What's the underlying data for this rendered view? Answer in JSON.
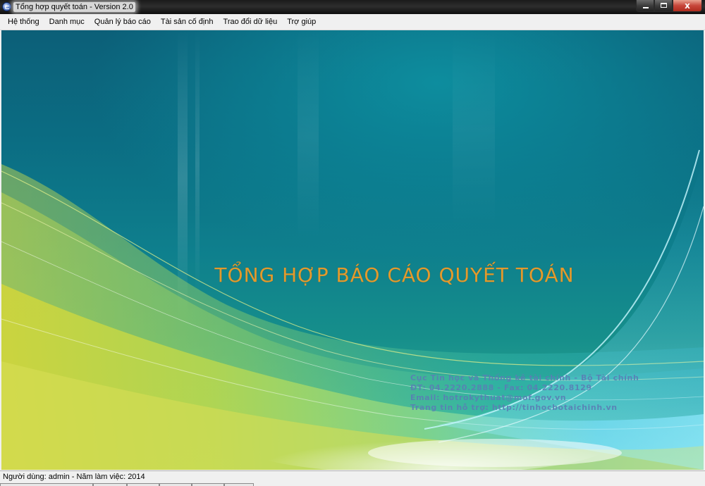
{
  "window": {
    "title": "Tổng hợp quyết toán - Version 2.0"
  },
  "caption_buttons": {
    "minimize_icon": "minimize-icon",
    "maximize_icon": "maximize-icon",
    "close_icon": "close-icon",
    "close_glyph": "x"
  },
  "menu": {
    "items": [
      {
        "label": "Hệ thống"
      },
      {
        "label": "Danh mục"
      },
      {
        "label": "Quản lý báo cáo"
      },
      {
        "label": "Tài sản cố định"
      },
      {
        "label": "Trao đổi dữ liệu"
      },
      {
        "label": "Trợ giúp"
      }
    ]
  },
  "splash": {
    "title": "TỔNG HỢP BÁO CÁO QUYẾT TOÁN",
    "title_color": "#e39a2c",
    "info_lines": [
      "Cục Tin học và Thống kê tài chính - Bộ Tài chính",
      "ĐT: 04.2220.2888 - Fax: 04.2220.8129",
      "Email: hotrokythuat@mof.gov.vn",
      "Trang tin hỗ trợ: http://tinhocbotaichinh.vn"
    ]
  },
  "status": {
    "text": "Người dùng: admin - Năm làm việc: 2014"
  }
}
